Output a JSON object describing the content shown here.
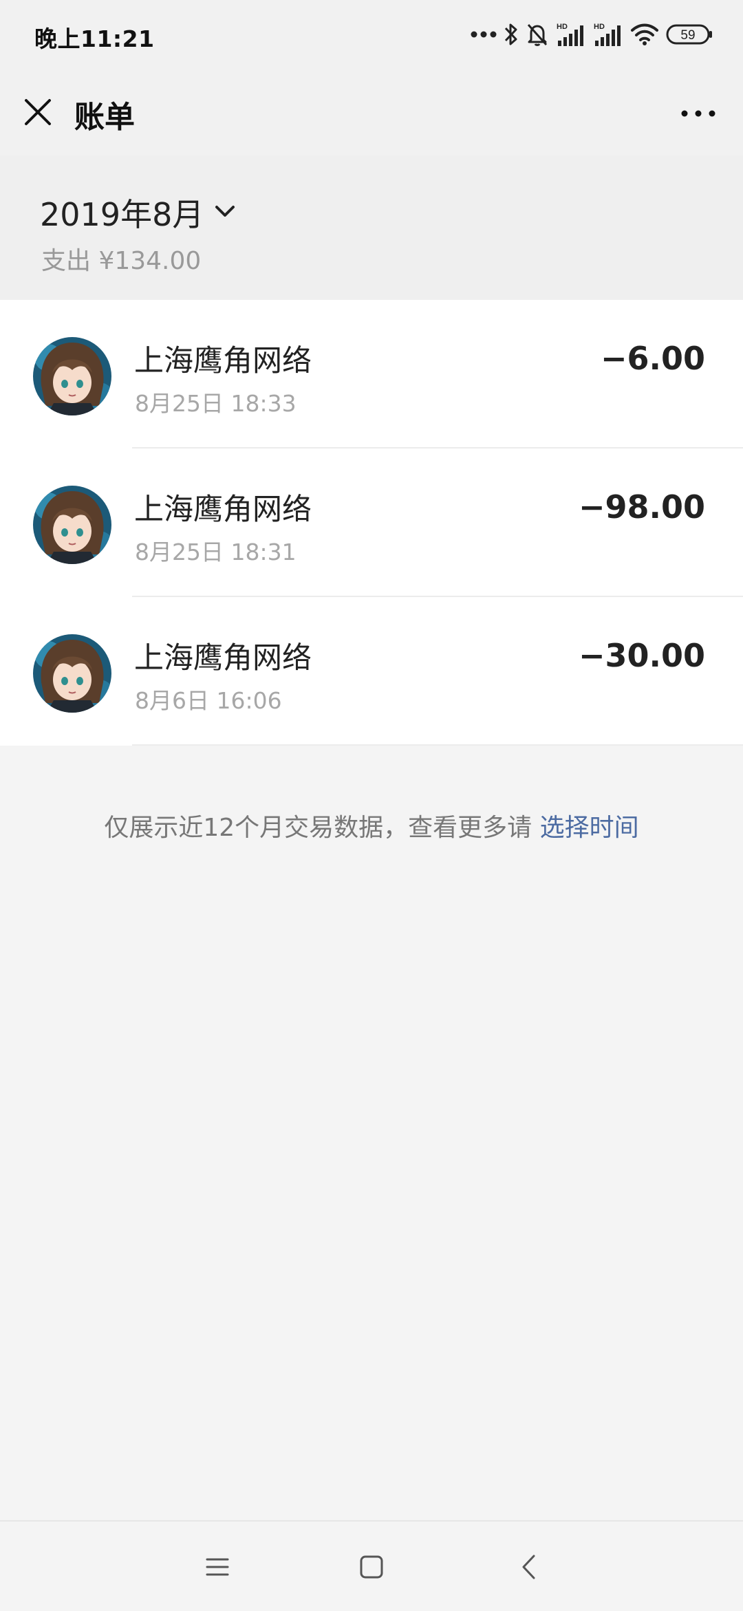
{
  "status_bar": {
    "time": "晚上11:21",
    "hd_label": "HD",
    "battery_percent": "59",
    "icons": [
      "more-dots-icon",
      "bluetooth-icon",
      "mute-bell-icon",
      "hd-signal-icon",
      "hd-signal-icon",
      "wifi-icon",
      "battery-icon"
    ]
  },
  "header": {
    "title": "账单",
    "close_icon": "close-icon",
    "more_icon": "more-dots-icon"
  },
  "summary": {
    "month": "2019年8月",
    "spend": "支出 ¥134.00"
  },
  "transactions": [
    {
      "merchant": "上海鹰角网络",
      "time": "8月25日 18:33",
      "amount": "−6.00"
    },
    {
      "merchant": "上海鹰角网络",
      "time": "8月25日 18:31",
      "amount": "−98.00"
    },
    {
      "merchant": "上海鹰角网络",
      "time": "8月6日 16:06",
      "amount": "−30.00"
    }
  ],
  "footer": {
    "note": "仅展示近12个月交易数据，查看更多请 ",
    "link": "选择时间"
  },
  "nav": {
    "icons": [
      "menu-icon",
      "home-icon",
      "back-icon"
    ]
  },
  "colors": {
    "link": "#4c6ba2",
    "background": "#f4f4f4",
    "secondary_text": "#a7a7a7"
  }
}
